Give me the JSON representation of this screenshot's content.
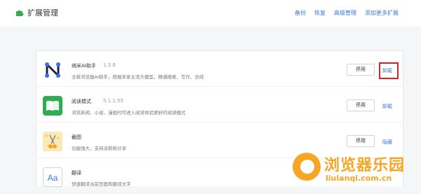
{
  "header": {
    "title": "扩展管理",
    "nav": [
      "备份",
      "恢复",
      "高级管理",
      "添加更多扩展"
    ]
  },
  "extensions": [
    {
      "name": "纳米AI助手",
      "version": "1.3.6",
      "desc": "全新浏览器AI助手，搭载多家主流大模型，精通搜索、写作、总结",
      "button": "停用",
      "link": "卸载",
      "icon": "nano-ai-icon"
    },
    {
      "name": "阅读模式",
      "version": "5.1.1.55",
      "desc": "浏览新闻、小说、漫画时可进入阅读体验更好的阅读模式",
      "button": "停用",
      "link": "卸载",
      "icon": "book-icon"
    },
    {
      "name": "截图",
      "version": "",
      "desc": "功能强大，支持涂鸦和分享",
      "button": "停用",
      "link": "隐藏",
      "icon": "scissors-icon"
    },
    {
      "name": "翻译",
      "version": "",
      "desc": "快速翻译当前页面和翻译文字",
      "button": "",
      "link": "",
      "icon": "translate-icon"
    }
  ],
  "watermark": {
    "title": "浏览器乐园",
    "subtitle": "liulanqi.com.cn"
  },
  "colors": {
    "accent": "#3c78d8",
    "highlight": "#e02020",
    "watermark": "#f6a623",
    "reading_green": "#2eae4f"
  }
}
